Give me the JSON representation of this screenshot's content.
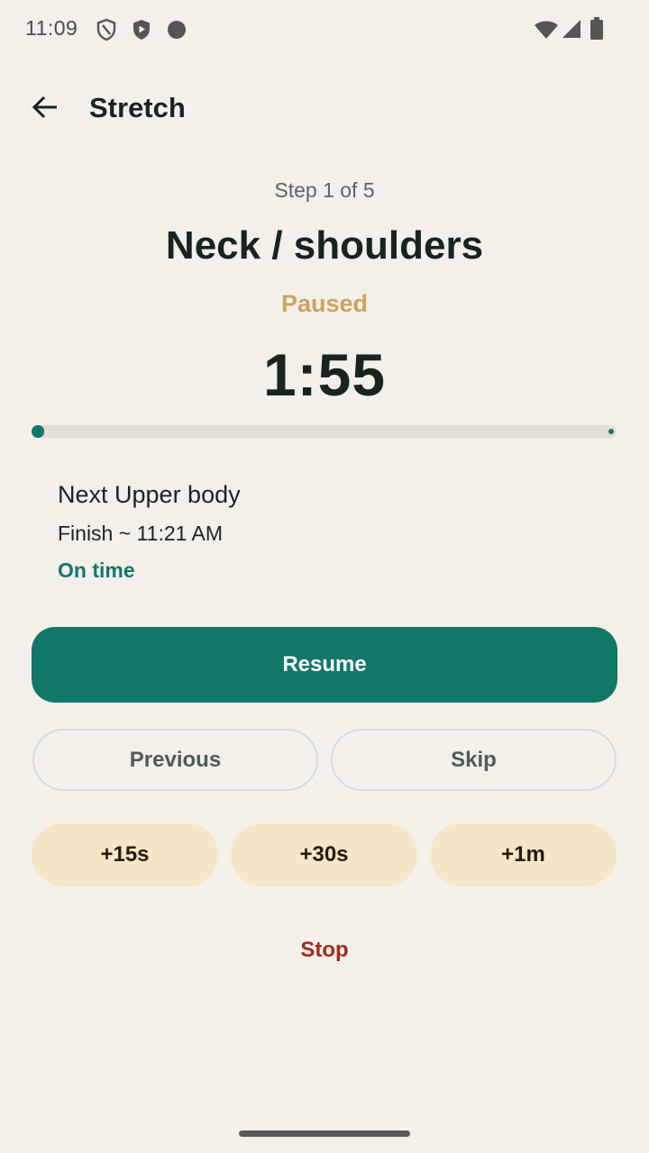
{
  "status_bar": {
    "time": "11:09",
    "left_icons": [
      "shield-outline-icon",
      "shield-play-icon",
      "circle-dot-icon"
    ],
    "right_icons": [
      "wifi-icon",
      "signal-icon",
      "battery-icon"
    ]
  },
  "app_bar": {
    "back_icon": "arrow-back-icon",
    "title": "Stretch"
  },
  "session": {
    "step_label": "Step 1 of 5",
    "exercise_name": "Neck / shoulders",
    "state": "Paused",
    "timer": "1:55",
    "progress_fraction": 0.02
  },
  "info": {
    "next": "Next  Upper body",
    "finish": "Finish ~ 11:21 AM",
    "pace": "On time"
  },
  "actions": {
    "resume": "Resume",
    "previous": "Previous",
    "skip": "Skip",
    "add_15s": "+15s",
    "add_30s": "+30s",
    "add_1m": "+1m",
    "stop": "Stop"
  },
  "colors": {
    "background": "#f3f0e9",
    "accent": "#117868",
    "paused": "#c9a35f",
    "chip": "#f4e6c6",
    "stop": "#a32a1c"
  }
}
